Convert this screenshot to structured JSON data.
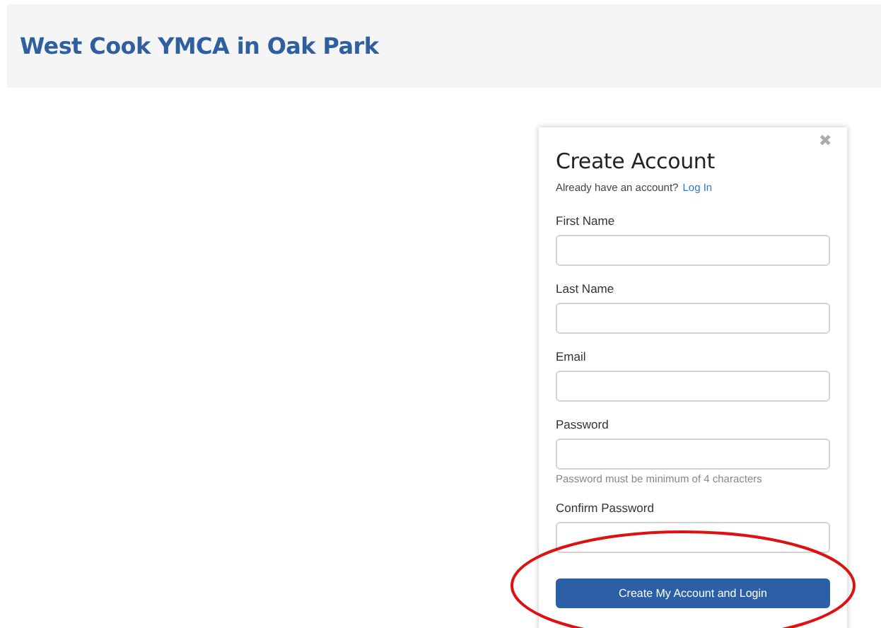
{
  "header": {
    "title": "West Cook YMCA in Oak Park"
  },
  "dialog": {
    "close": "✖",
    "title": "Create Account",
    "prompt": "Already have an account?",
    "login_link": "Log In",
    "fields": [
      {
        "label": "First Name"
      },
      {
        "label": "Last Name"
      },
      {
        "label": "Email"
      },
      {
        "label": "Password",
        "hint": "Password must be minimum of 4 characters"
      },
      {
        "label": "Confirm Password"
      }
    ],
    "submit": "Create My Account and Login"
  },
  "highlight": {
    "kind": "ellipse"
  }
}
